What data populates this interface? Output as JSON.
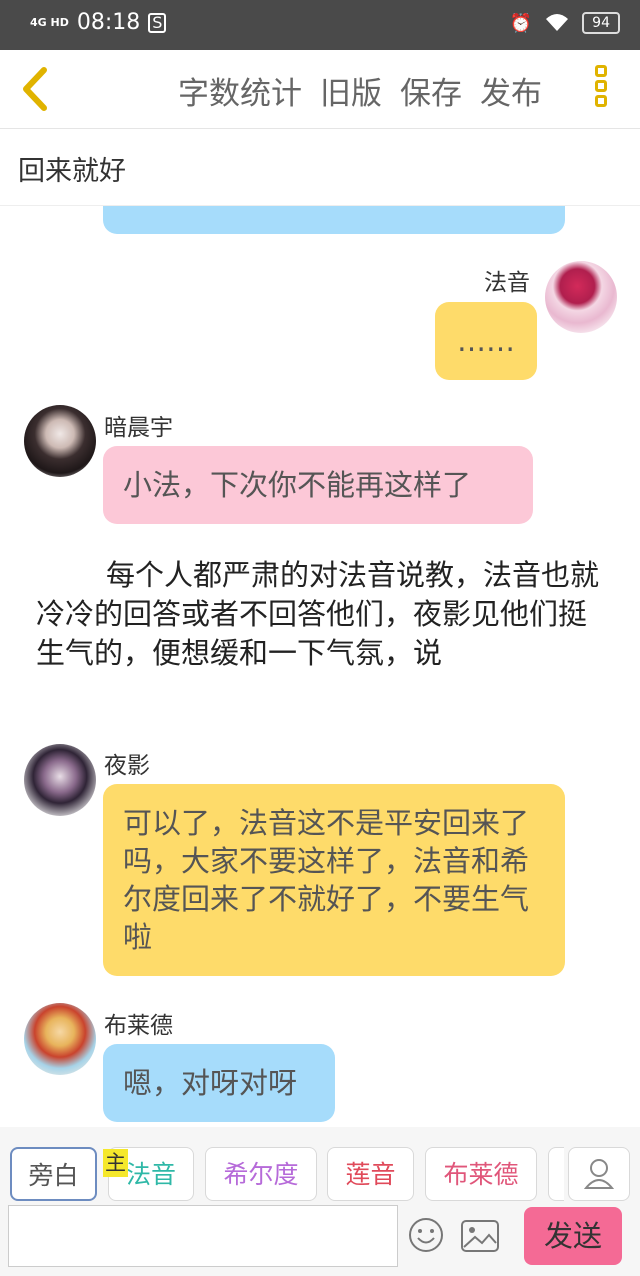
{
  "status_bar": {
    "network": "4G HD",
    "time": "08:18",
    "battery": "94"
  },
  "toolbar": {
    "word_count": "字数统计",
    "old_version": "旧版",
    "save": "保存",
    "publish": "发布"
  },
  "title": "回来就好",
  "messages": [
    {
      "speaker": "法音",
      "text": "……"
    },
    {
      "speaker": "暗晨宇",
      "text": "小法，下次你不能再这样了"
    },
    {
      "narration": "每个人都严肃的对法音说教，法音也就冷冷的回答或者不回答他们，夜影见他们挺生气的，便想缓和一下气氛，说"
    },
    {
      "speaker": "夜影",
      "text": "可以了，法音这不是平安回来了吗，大家不要这样了，法音和希尔度回来了不就好了，不要生气啦"
    },
    {
      "speaker": "布莱德",
      "text": "嗯，对呀对呀"
    }
  ],
  "role_chips": [
    "旁白",
    "法音",
    "希尔度",
    "莲音",
    "布莱德"
  ],
  "main_tag": "主",
  "send_label": "发送",
  "colors": {
    "blue_bubble": "#a6dcfb",
    "yellow_bubble": "#fedb6a",
    "pink_bubble": "#fcc8d7",
    "send_button": "#f46a95",
    "accent": "#e0b300"
  }
}
